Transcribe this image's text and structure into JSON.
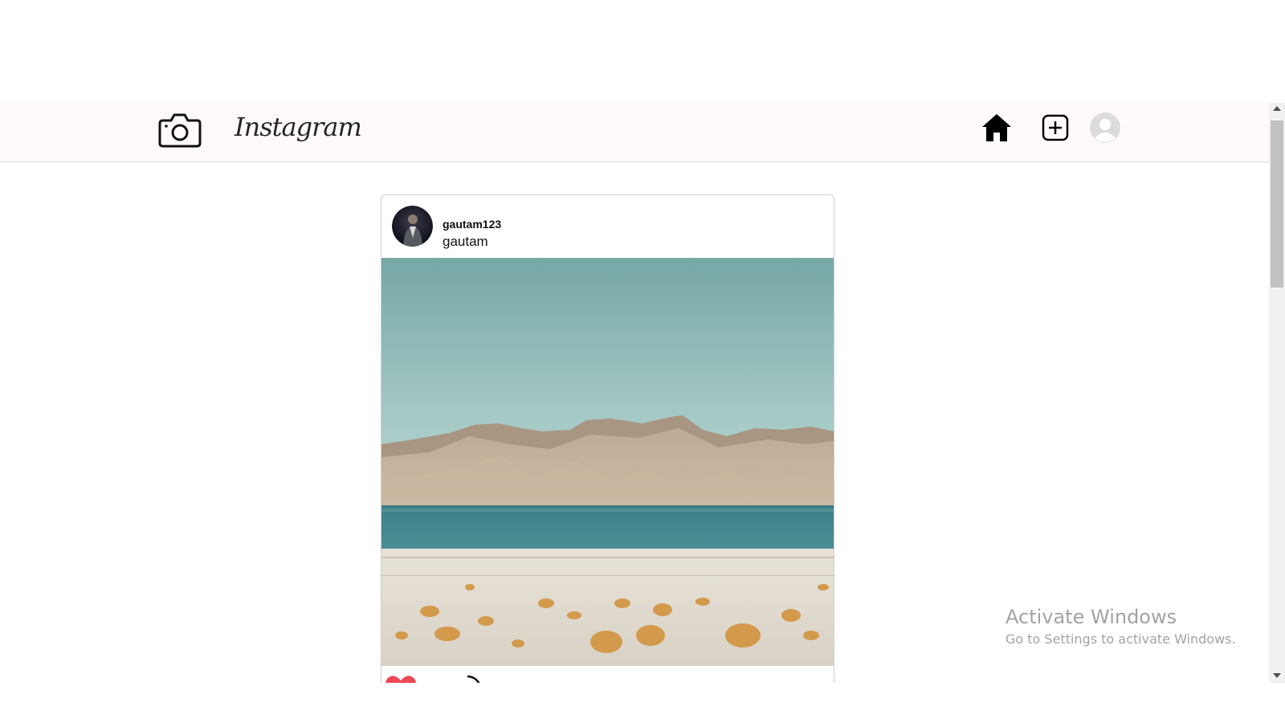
{
  "navbar": {
    "logo_text": "Instagram",
    "icons": [
      "camera-icon",
      "home-icon",
      "add-post-icon",
      "user-avatar-icon"
    ],
    "background": "#fffaf9"
  },
  "post": {
    "username": "gautam123",
    "caption": "gautam",
    "actions": [
      "heart-icon",
      "comment-icon"
    ],
    "liked_color": "#ed4956"
  },
  "watermark": {
    "title": "Activate Windows",
    "subtitle": "Go to Settings to activate Windows."
  }
}
